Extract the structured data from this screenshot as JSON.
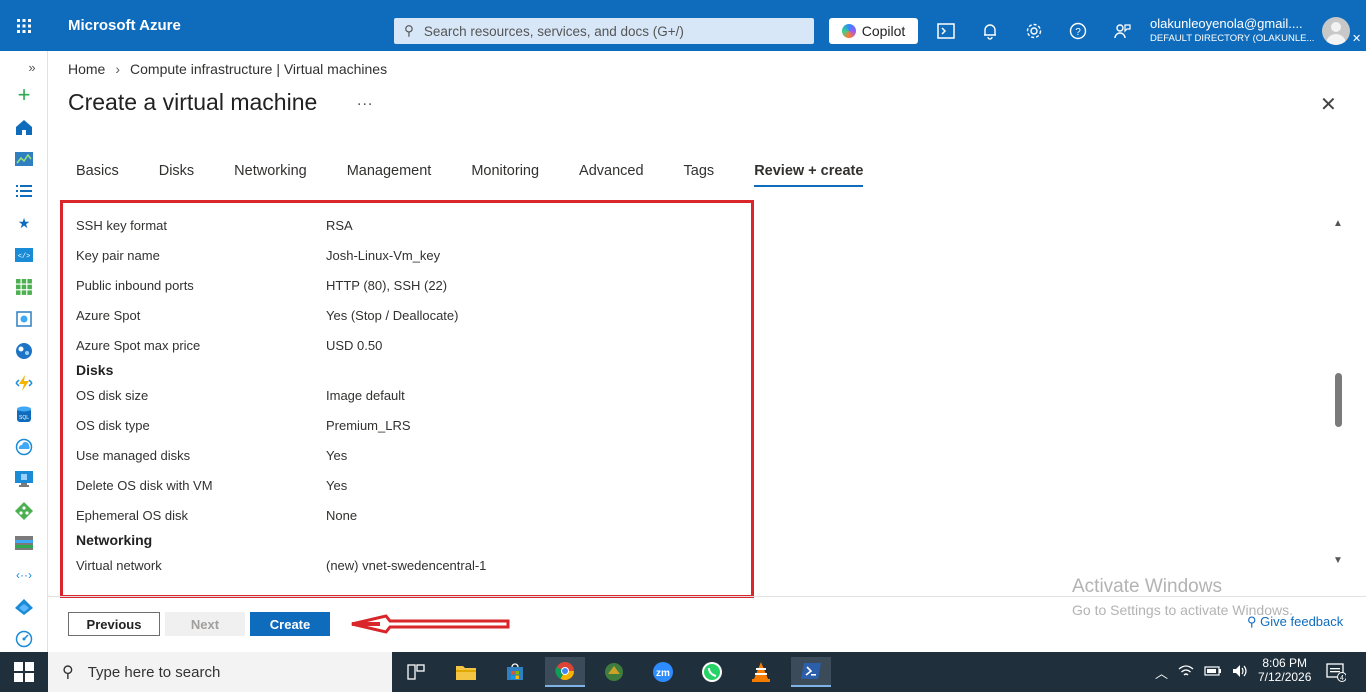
{
  "topbar": {
    "brand": "Microsoft Azure",
    "search_placeholder": "Search resources, services, and docs (G+/)",
    "copilot_label": "Copilot",
    "account_email": "olakunleoyenola@gmail....",
    "account_directory": "DEFAULT DIRECTORY (OLAKUNLE..."
  },
  "sidebar": {
    "icons": [
      "collapse-icon",
      "create-icon",
      "home-icon",
      "dashboard-icon",
      "all-services-icon",
      "favorites-icon",
      "resource-groups-icon",
      "all-resources-icon",
      "cosmos-icon",
      "app-services-icon",
      "function-icon",
      "sql-icon",
      "cloud-icon",
      "vm-icon",
      "load-balancer-icon",
      "storage-icon",
      "vnet-icon",
      "entra-icon",
      "monitor-icon"
    ]
  },
  "breadcrumb": {
    "home": "Home",
    "current": "Compute infrastructure | Virtual machines"
  },
  "page": {
    "title": "Create a virtual machine",
    "more": "...",
    "close": "✕"
  },
  "tabs": [
    "Basics",
    "Disks",
    "Networking",
    "Management",
    "Monitoring",
    "Advanced",
    "Tags",
    "Review + create"
  ],
  "review": {
    "rows_top": [
      {
        "k": "SSH key format",
        "v": "RSA"
      },
      {
        "k": "Key pair name",
        "v": "Josh-Linux-Vm_key"
      },
      {
        "k": "Public inbound ports",
        "v": "HTTP (80), SSH (22)"
      },
      {
        "k": "Azure Spot",
        "v": "Yes (Stop / Deallocate)"
      },
      {
        "k": "Azure Spot max price",
        "v": "USD 0.50"
      }
    ],
    "disks_heading": "Disks",
    "disks_rows": [
      {
        "k": "OS disk size",
        "v": "Image default"
      },
      {
        "k": "OS disk type",
        "v": "Premium_LRS"
      },
      {
        "k": "Use managed disks",
        "v": "Yes"
      },
      {
        "k": "Delete OS disk with VM",
        "v": "Yes"
      },
      {
        "k": "Ephemeral OS disk",
        "v": "None"
      }
    ],
    "networking_heading": "Networking",
    "networking_rows": [
      {
        "k": "Virtual network",
        "v": "(new) vnet-swedencentral-1"
      }
    ]
  },
  "footer": {
    "previous": "Previous",
    "next": "Next",
    "create": "Create",
    "watermark_title": "Activate Windows",
    "watermark_sub": "Go to Settings to activate Windows.",
    "feedback": "Give feedback"
  },
  "taskbar": {
    "search_placeholder": "Type here to search",
    "time": "8:06 PM",
    "date": "7/12/2026",
    "notifications": "4",
    "apps": [
      "task-view-icon",
      "file-explorer-icon",
      "store-icon",
      "chrome-icon",
      "app-icon",
      "zoom-icon",
      "whatsapp-icon",
      "vlc-icon",
      "powershell-icon"
    ]
  },
  "colors": {
    "azure_blue": "#0f6cbd",
    "highlight_red": "#d9262b"
  }
}
